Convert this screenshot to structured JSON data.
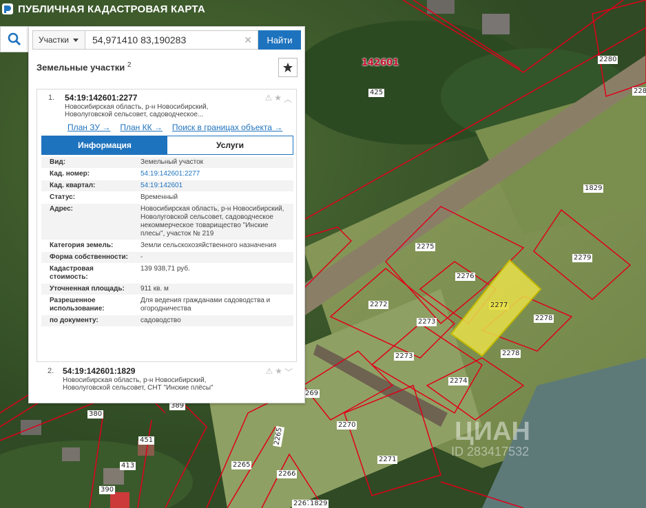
{
  "header": {
    "title": "ПУБЛИЧНАЯ КАДАСТРОВАЯ КАРТА"
  },
  "search": {
    "type": "Участки",
    "query": "54,971410 83,190283",
    "button": "Найти"
  },
  "panel": {
    "title": "Земельные участки",
    "count": "2"
  },
  "results": [
    {
      "num": "1.",
      "cad": "54:19:142601:2277",
      "addr": "Новосибирская область, р-н Новосибирский, Новолуговской сельсовет, садоводческое...",
      "links": [
        "План ЗУ →",
        "План КК →",
        "Поиск в границах объекта →"
      ],
      "tabs": [
        "Информация",
        "Услуги"
      ],
      "info": [
        {
          "k": "Вид:",
          "v": "Земельный участок"
        },
        {
          "k": "Кад. номер:",
          "v": "54:19:142601:2277"
        },
        {
          "k": "Кад. квартал:",
          "v": "54:19:142601"
        },
        {
          "k": "Статус:",
          "v": "Временный"
        },
        {
          "k": "Адрес:",
          "v": "Новосибирская область, р-н Новосибирский, Новолуговской сельсовет, садоводческое некоммерческое товарищество \"Инские плесы\", участок № 219"
        },
        {
          "k": "Категория земель:",
          "v": "Земли сельскохозяйственного назначения"
        },
        {
          "k": "Форма собственности:",
          "v": "-"
        },
        {
          "k": "Кадастровая стоимость:",
          "v": "139 938,71 руб."
        },
        {
          "k": "Уточненная площадь:",
          "v": "911 кв. м"
        },
        {
          "k": "Разрешенное использование:",
          "v": "Для ведения гражданами садоводства и огородничества"
        },
        {
          "k": "по документу:",
          "v": "садоводство"
        }
      ]
    },
    {
      "num": "2.",
      "cad": "54:19:142601:1829",
      "addr": "Новосибирская область, р-н Новосибирский, Новолуговской сельсовет, СНТ \"Инские плёсы\""
    }
  ],
  "map": {
    "quarter": "142601",
    "parcels": [
      "425",
      "2280",
      "228",
      "1829",
      "2275",
      "2279",
      "2276",
      "2277",
      "2272",
      "2273",
      "2278",
      "2273",
      "2278",
      "2274",
      "2270",
      "269",
      "2265",
      "2271",
      "2265",
      "2266",
      "2267",
      "1829",
      "380",
      "451",
      "413",
      "389",
      "390"
    ],
    "watermark": {
      "brand": "ЦИАН",
      "id": "ID 283417532"
    }
  },
  "colors": {
    "accent": "#1e73be",
    "boundary": "#e0001a",
    "selected": "#e8e04a"
  }
}
